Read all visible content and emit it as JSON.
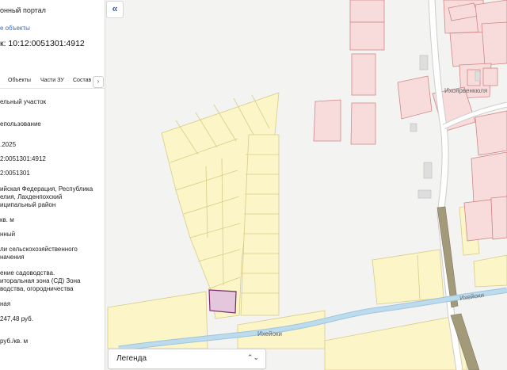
{
  "panel": {
    "portal_title": "онный портал",
    "objects_link": "е объекты",
    "cadastral_number": "к: 10:12:0051301:4912",
    "tabs": [
      {
        "label": "Объекты"
      },
      {
        "label": "Части ЗУ"
      },
      {
        "label": "Состав"
      }
    ],
    "tab_scroll_icon": "chevron-right-icon",
    "fields": [
      {
        "lines": [
          "ельный участок"
        ]
      },
      {
        "lines": [
          "епользование"
        ]
      },
      {
        "lines": [
          ".2025"
        ]
      },
      {
        "lines": [
          "2:0051301:4912"
        ]
      },
      {
        "lines": [
          "2:0051301"
        ]
      },
      {
        "lines": [
          "ийская Федерация, Республика",
          "елия, Лахденпохский",
          "иципальный район"
        ]
      },
      {
        "lines": [
          "кв. м"
        ]
      },
      {
        "lines": [
          "нный"
        ]
      },
      {
        "lines": [
          "ли сельскохозяйственного",
          "начения"
        ]
      },
      {
        "lines": [
          "ение садоводства.",
          "иторальная зона (СД) Зона",
          "водства, огородничества"
        ]
      },
      {
        "lines": [
          "ная"
        ]
      },
      {
        "lines": [
          "247,48 руб."
        ]
      },
      {
        "lines": [
          "руб./кв. м"
        ]
      }
    ]
  },
  "map": {
    "collapse_icon": "double-chevron-left-icon",
    "labels": {
      "village": "Ихоярвенкюля",
      "river_west": "Ихейоки",
      "river_east": "Ихейоки"
    },
    "legend": {
      "label": "Легенда",
      "icon": "chevron-updown-icon"
    },
    "colors": {
      "parcel_yellow": "#fbf5c8",
      "parcel_yellow_border": "#d9cf85",
      "parcel_red": "#f8dcdc",
      "parcel_red_border": "#d28686",
      "selected_parcel": "#e6c8de",
      "selected_parcel_border": "#7a2a6a",
      "river": "#b9d8ea",
      "road": "#ffffff",
      "railway": "#8f8f7a"
    }
  }
}
